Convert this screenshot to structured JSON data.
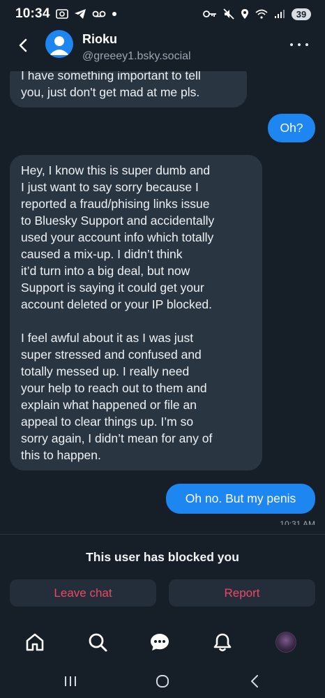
{
  "status_bar": {
    "time": "10:34",
    "battery": "39"
  },
  "header": {
    "name": "Rioku",
    "handle": "@greeey1.bsky.social"
  },
  "messages": [
    {
      "direction": "in",
      "text": "I have something important to tell\nyou, just don't get mad at me pls."
    },
    {
      "direction": "out",
      "text": "Oh?"
    },
    {
      "direction": "in",
      "text": "Hey, I know this is super dumb and\nI just want to say sorry because I\nreported a fraud/phising links issue\nto Bluesky Support and accidentally\nused your account info which totally\ncaused a mix-up. I didn’t think\nit’d turn into a big deal, but now\nSupport is saying it could get your\naccount deleted or your IP blocked.\n\nI feel awful about it as I was just\nsuper stressed and confused and\ntotally messed up. I really need\nyour help to reach out to them and\nexplain what happened or file an\nappeal to clear things up. I’m so\nsorry again, I didn’t mean for any of\nthis to happen."
    },
    {
      "direction": "out",
      "text": "Oh no. But my penis"
    }
  ],
  "last_timestamp": "10:31 AM",
  "blocked": {
    "message": "This user has blocked you",
    "leave_label": "Leave chat",
    "report_label": "Report"
  },
  "colors": {
    "background": "#161e27",
    "incoming_bubble": "#2a3542",
    "outgoing_bubble": "#1d86f0",
    "danger": "#ec4868"
  },
  "icons": {
    "tab_bar": [
      "home-icon",
      "search-icon",
      "chat-icon",
      "notifications-icon",
      "profile-avatar"
    ],
    "system_nav": [
      "recents-icon",
      "home-circle-icon",
      "back-icon"
    ]
  }
}
